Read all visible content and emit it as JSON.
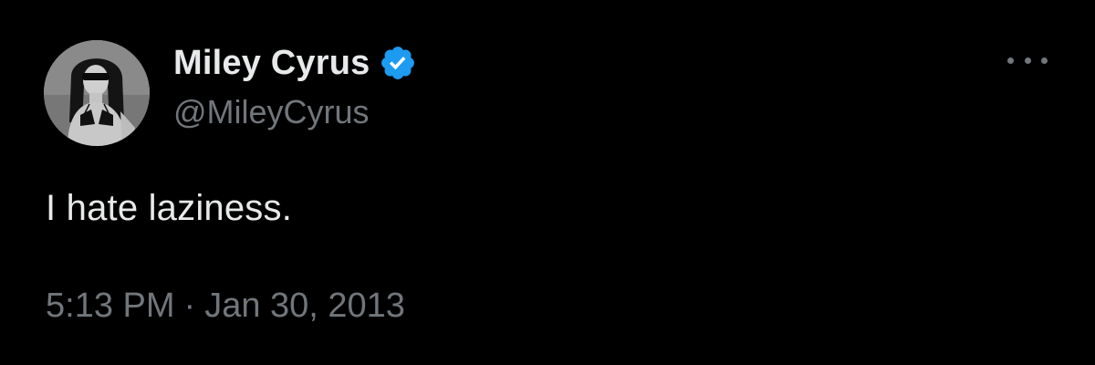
{
  "author": {
    "display_name": "Miley Cyrus",
    "handle": "@MileyCyrus",
    "verified": true,
    "avatar_icon": "profile-photo"
  },
  "tweet": {
    "text": "I hate laziness.",
    "time": "5:13 PM",
    "separator": "·",
    "date": "Jan 30, 2013"
  },
  "icons": {
    "verified_badge": "verified-badge-icon",
    "more": "more-options-icon"
  },
  "colors": {
    "background": "#000000",
    "primary_text": "#e7e9ea",
    "secondary_text": "#71767b",
    "verified_blue": "#1d9bf0"
  }
}
